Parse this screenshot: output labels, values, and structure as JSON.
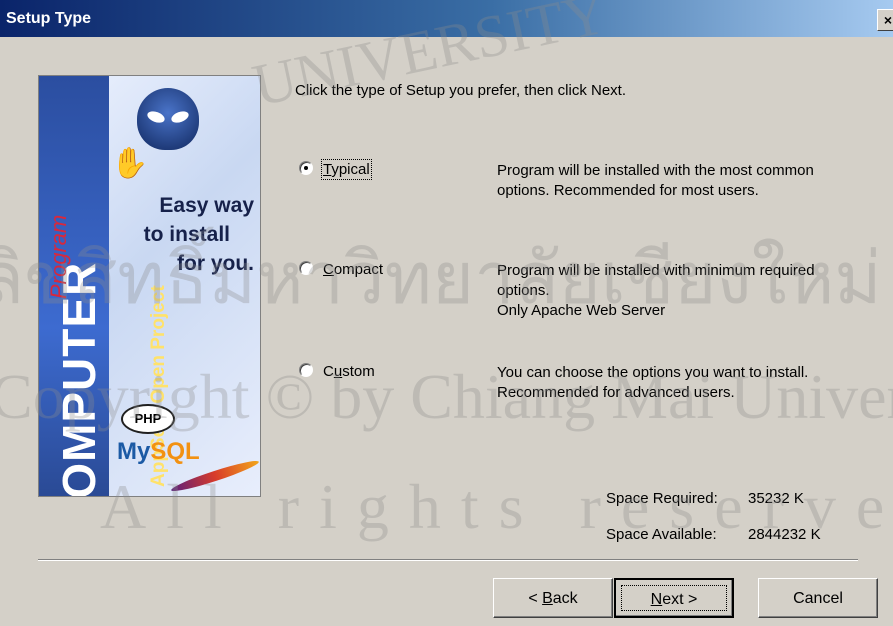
{
  "window": {
    "title": "Setup Type",
    "close_label": "×"
  },
  "banner": {
    "brand": "COMPUTER",
    "subtitle": "AppServ Open Project",
    "script_word": "Program",
    "slogan": [
      "Easy way",
      "to install",
      "for you."
    ],
    "php": "PHP",
    "mysql_a": "My",
    "mysql_b": "SQL"
  },
  "prompt": "Click the type of Setup you prefer, then click Next.",
  "options": [
    {
      "label": "Typical",
      "mnemonic": "T",
      "rest": "ypical",
      "selected": true,
      "desc": [
        "Program will be installed with the most common",
        "options. Recommended for most users."
      ]
    },
    {
      "label": "Compact",
      "mnemonic": "C",
      "rest": "ompact",
      "selected": false,
      "desc": [
        "Program will be installed with minimum required",
        "options.",
        "Only Apache Web Server"
      ]
    },
    {
      "label": "Custom",
      "mnemonic": "u",
      "pre": "C",
      "rest": "stom",
      "selected": false,
      "desc": [
        "You can choose the options you want to install.",
        "Recommended for advanced users."
      ]
    }
  ],
  "space": {
    "required_label": "Space Required:",
    "required_value": "35232 K",
    "available_label": "Space Available:",
    "available_value": "2844232 K"
  },
  "buttons": {
    "back_pre": "< ",
    "back_mn": "B",
    "back_rest": "ack",
    "next_mn": "N",
    "next_rest": "ext >",
    "cancel": "Cancel"
  },
  "watermark": {
    "line1": "UNIVERSITY",
    "line2": "ลิขสิทธิ์มหาวิทยาลัยเชียงใหม่",
    "line3": "Copyright © by Chiang Mai University",
    "line4": "All rights reserved"
  }
}
